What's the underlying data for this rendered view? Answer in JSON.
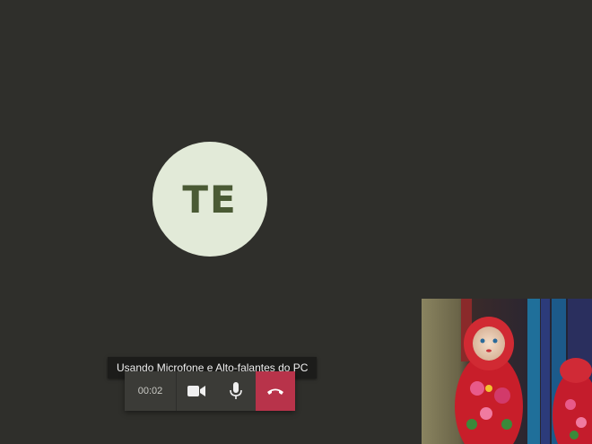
{
  "remote": {
    "initials": "TE",
    "avatar_color": "#e2ead8",
    "initials_color": "#4a5a34"
  },
  "tooltip": {
    "text": "Usando Microfone e Alto-falantes do PC"
  },
  "controls": {
    "timer": "00:02",
    "camera_icon": "video-camera-icon",
    "mic_icon": "microphone-icon",
    "hangup_icon": "phone-hangup-icon",
    "hangup_color": "#b8334a"
  },
  "self_view": {
    "description_icon": "self-camera-preview"
  },
  "background_color": "#2f2f2b"
}
